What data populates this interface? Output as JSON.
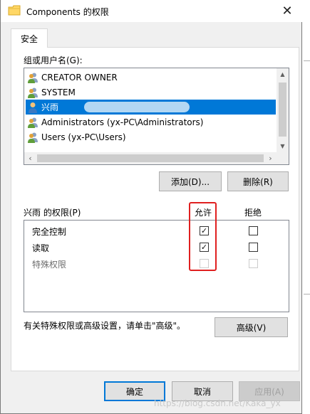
{
  "window": {
    "title": "Components 的权限"
  },
  "tabs": [
    {
      "label": "安全"
    }
  ],
  "groups": {
    "label": "组或用户名(G):",
    "items": [
      {
        "name": "CREATOR OWNER",
        "icon": "group-icon",
        "selected": false
      },
      {
        "name": "SYSTEM",
        "icon": "group-icon",
        "selected": false
      },
      {
        "name": "兴雨",
        "icon": "user-icon",
        "selected": true
      },
      {
        "name": "Administrators (yx-PC\\Administrators)",
        "icon": "group-icon",
        "selected": false
      },
      {
        "name": "Users (yx-PC\\Users)",
        "icon": "group-icon",
        "selected": false
      }
    ]
  },
  "buttons": {
    "add": "添加(D)...",
    "remove": "删除(R)",
    "advanced": "高级(V)",
    "ok": "确定",
    "cancel": "取消",
    "apply": "应用(A)"
  },
  "permissions": {
    "title": "兴雨 的权限(P)",
    "allow_header": "允许",
    "deny_header": "拒绝",
    "rows": [
      {
        "name": "完全控制",
        "allow": true,
        "deny": false,
        "enabled": true
      },
      {
        "name": "读取",
        "allow": true,
        "deny": false,
        "enabled": true
      },
      {
        "name": "特殊权限",
        "allow": false,
        "deny": false,
        "enabled": false
      }
    ]
  },
  "advanced_hint": "有关特殊权限或高级设置，请单击\"高级\"。",
  "watermark": "https://blog.csdn.net/Kaka_yx",
  "colors": {
    "selection": "#0078d7",
    "highlight": "#e02020"
  }
}
